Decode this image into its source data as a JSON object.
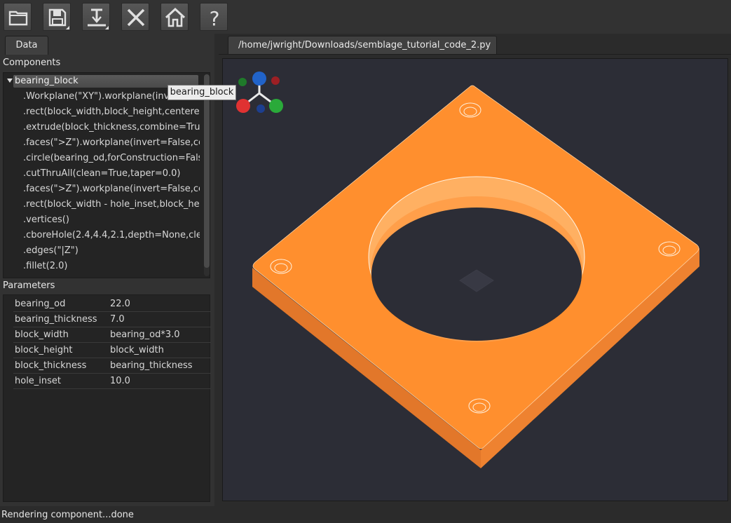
{
  "toolbar": {
    "buttons": [
      {
        "name": "open",
        "icon": "folder-icon"
      },
      {
        "name": "save",
        "icon": "save-icon"
      },
      {
        "name": "export",
        "icon": "export-icon"
      },
      {
        "name": "close",
        "icon": "close-icon"
      },
      {
        "name": "home",
        "icon": "home-icon"
      },
      {
        "name": "help",
        "icon": "help-icon"
      }
    ]
  },
  "left_panel": {
    "tab_label": "Data",
    "components_title": "Components",
    "tree": {
      "root_label": "bearing_block",
      "children": [
        ".Workplane(\"XY\").workplane(invert=Fals",
        ".rect(block_width,block_height,centere",
        ".extrude(block_thickness,combine=Tru",
        ".faces(\">Z\").workplane(invert=False,cen",
        ".circle(bearing_od,forConstruction=Fals",
        ".cutThruAll(clean=True,taper=0.0)",
        ".faces(\">Z\").workplane(invert=False,cen",
        ".rect(block_width - hole_inset,block_hei",
        ".vertices()",
        ".cboreHole(2.4,4.4,2.1,depth=None,cle",
        ".edges(\"|Z\")",
        ".fillet(2.0)"
      ]
    },
    "parameters_title": "Parameters",
    "parameters": [
      {
        "name": "bearing_od",
        "value": "22.0"
      },
      {
        "name": "bearing_thickness",
        "value": "7.0"
      },
      {
        "name": "block_width",
        "value": "bearing_od*3.0"
      },
      {
        "name": "block_height",
        "value": "block_width"
      },
      {
        "name": "block_thickness",
        "value": "bearing_thickness"
      },
      {
        "name": "hole_inset",
        "value": "10.0"
      }
    ]
  },
  "editor": {
    "file_tab": "/home/jwright/Downloads/semblage_tutorial_code_2.py",
    "tooltip": "bearing_block"
  },
  "colors": {
    "part_orange": "#ff8f2e",
    "background": "#2c2d36"
  },
  "status": {
    "text": "Rendering component...done"
  }
}
